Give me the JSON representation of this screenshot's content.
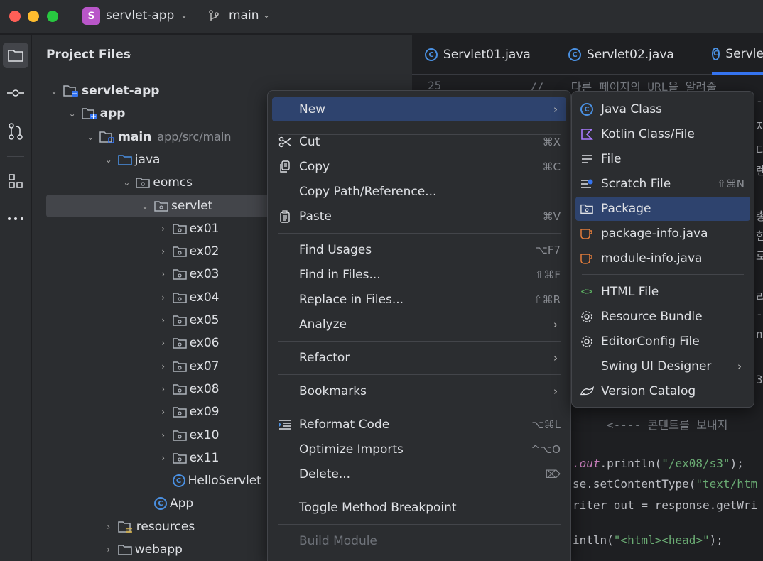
{
  "titlebar": {
    "project_badge": "S",
    "project_name": "servlet-app",
    "branch_name": "main"
  },
  "project_panel": {
    "title": "Project Files",
    "tree": [
      {
        "label": "servlet-app",
        "bold": true
      },
      {
        "label": "app",
        "bold": true
      },
      {
        "label": "main",
        "bold": true,
        "sub": "app/src/main"
      },
      {
        "label": "java"
      },
      {
        "label": "eomcs"
      },
      {
        "label": "servlet"
      },
      {
        "label": "ex01"
      },
      {
        "label": "ex02"
      },
      {
        "label": "ex03"
      },
      {
        "label": "ex04"
      },
      {
        "label": "ex05"
      },
      {
        "label": "ex06"
      },
      {
        "label": "ex07"
      },
      {
        "label": "ex08"
      },
      {
        "label": "ex09"
      },
      {
        "label": "ex10"
      },
      {
        "label": "ex11"
      },
      {
        "label": "HelloServlet"
      },
      {
        "label": "App"
      },
      {
        "label": "resources"
      },
      {
        "label": "webapp"
      }
    ]
  },
  "editor": {
    "tabs": [
      "Servlet01.java",
      "Servlet02.java",
      "Servle"
    ],
    "line_number": "25",
    "code_lines": [
      "//    다른 페이지의 URL을 알려줄",
      "<---- 콘텐트를 보내지",
      ".out.println(\"/ex08/s3\");",
      "se.setContentType(\"text/htm",
      "riter out = response.getWri",
      "intln(\"<html><head>\");"
    ],
    "edge_fragments": [
      "-",
      "자",
      "다",
      "렌",
      "총",
      "한",
      "로",
      "리",
      "-0",
      "na",
      "3"
    ]
  },
  "context_menu": {
    "items": [
      {
        "label": "New"
      },
      {
        "label": "Cut",
        "shortcut": "⌘X"
      },
      {
        "label": "Copy",
        "shortcut": "⌘C"
      },
      {
        "label": "Copy Path/Reference..."
      },
      {
        "label": "Paste",
        "shortcut": "⌘V"
      },
      {
        "label": "Find Usages",
        "shortcut": "⌥F7"
      },
      {
        "label": "Find in Files...",
        "shortcut": "⇧⌘F"
      },
      {
        "label": "Replace in Files...",
        "shortcut": "⇧⌘R"
      },
      {
        "label": "Analyze"
      },
      {
        "label": "Refactor"
      },
      {
        "label": "Bookmarks"
      },
      {
        "label": "Reformat Code",
        "shortcut": "⌥⌘L"
      },
      {
        "label": "Optimize Imports",
        "shortcut": "^⌥O"
      },
      {
        "label": "Delete...",
        "shortcut": "⌦"
      },
      {
        "label": "Toggle Method Breakpoint"
      },
      {
        "label": "Build Module"
      }
    ]
  },
  "new_submenu": {
    "items": [
      {
        "label": "Java Class"
      },
      {
        "label": "Kotlin Class/File"
      },
      {
        "label": "File"
      },
      {
        "label": "Scratch File",
        "shortcut": "⇧⌘N"
      },
      {
        "label": "Package"
      },
      {
        "label": "package-info.java"
      },
      {
        "label": "module-info.java"
      },
      {
        "label": "HTML File"
      },
      {
        "label": "Resource Bundle"
      },
      {
        "label": "EditorConfig File"
      },
      {
        "label": "Swing UI Designer"
      },
      {
        "label": "Version Catalog"
      }
    ]
  },
  "colors": {
    "accent": "#3574f0",
    "menu_highlight": "#2e436e",
    "panel_bg": "#2b2d30",
    "editor_bg": "#1e1f22"
  }
}
